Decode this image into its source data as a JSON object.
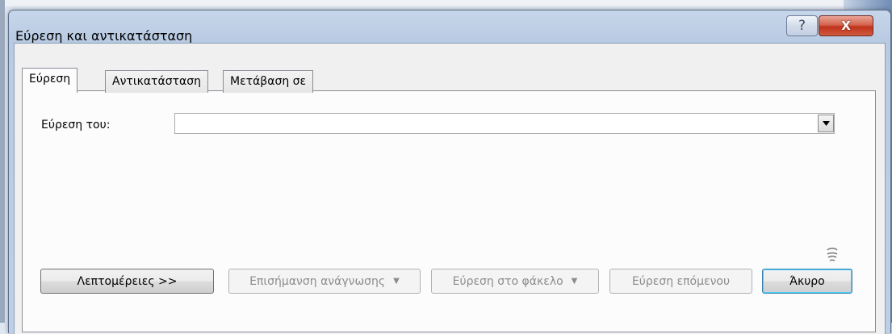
{
  "window": {
    "title": "Εύρεση και αντικατάσταση",
    "help_glyph": "?",
    "close_glyph": "X"
  },
  "tabs": [
    {
      "label": "Εύρεση",
      "active": true
    },
    {
      "label": "Αντικατάσταση",
      "active": false
    },
    {
      "label": "Μετάβαση σε",
      "active": false
    }
  ],
  "find": {
    "label": "Εύρεση του:",
    "value": ""
  },
  "buttons": {
    "more": "Λεπτομέρειες >>",
    "reading_highlight": "Επισήμανση ανάγνωσης",
    "find_in": "Εύρεση στο φάκελο",
    "find_next": "Εύρεση επόμενου",
    "cancel": "Άκυρο"
  },
  "icons": {
    "dropdown": "chevron-down-icon",
    "cursor": "busy-cursor-icon"
  }
}
